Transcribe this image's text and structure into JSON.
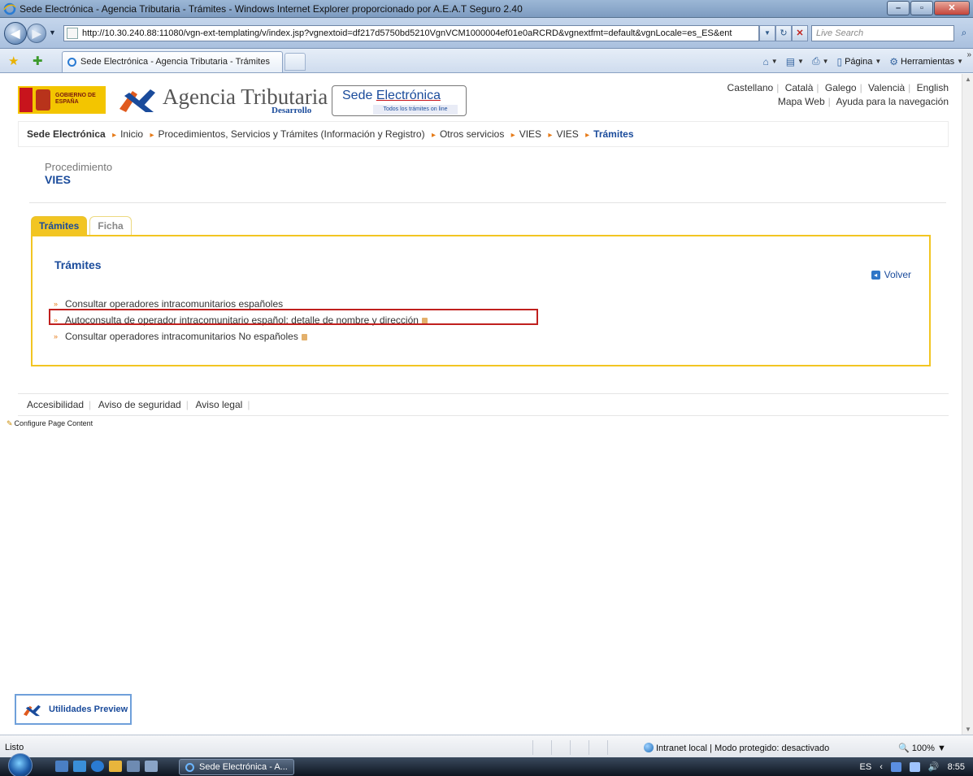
{
  "window": {
    "title": "Sede Electrónica - Agencia Tributaria - Trámites - Windows Internet Explorer proporcionado por A.E.A.T Seguro 2.40",
    "url": "http://10.30.240.88:11080/vgn-ext-templating/v/index.jsp?vgnextoid=df217d5750bd5210VgnVCM1000004ef01e0aRCRD&vgnextfmt=default&vgnLocale=es_ES&ent",
    "search_placeholder": "Live Search",
    "tab_title": "Sede Electrónica - Agencia Tributaria - Trámites",
    "toolbar": {
      "page_label": "Página",
      "tools_label": "Herramientas"
    }
  },
  "header": {
    "gov_logo_text": "GOBIERNO DE ESPAÑA",
    "agency_name": "Agencia Tributaria",
    "agency_sub": "Desarrollo",
    "sede_title_pre": "Sede ",
    "sede_title_u": "Electrónica",
    "sede_tagline": "Todos los trámites on line",
    "languages": [
      "Castellano",
      "Català",
      "Galego",
      "Valencià",
      "English"
    ],
    "links": [
      "Mapa Web",
      "Ayuda para la navegación"
    ]
  },
  "breadcrumb": {
    "root": "Sede Electrónica",
    "items": [
      "Inicio",
      "Procedimientos, Servicios y Trámites (Información y Registro)",
      "Otros servicios",
      "VIES",
      "VIES"
    ],
    "current": "Trámites"
  },
  "procedure": {
    "label": "Procedimiento",
    "name": "VIES"
  },
  "tabs": [
    {
      "label": "Trámites",
      "active": true
    },
    {
      "label": "Ficha",
      "active": false
    }
  ],
  "panel": {
    "title": "Trámites",
    "back_label": "Volver",
    "items": [
      {
        "label": "Consultar operadores intracomunitarios españoles",
        "secure": false
      },
      {
        "label": "Autoconsulta de operador intracomunitario español: detalle de nombre y dirección",
        "secure": true,
        "highlighted": true
      },
      {
        "label": "Consultar operadores intracomunitarios No españoles",
        "secure": true
      }
    ]
  },
  "footer": {
    "links": [
      "Accesibilidad",
      "Aviso de seguridad",
      "Aviso legal"
    ],
    "configure": "Configure Page Content"
  },
  "preview": {
    "label": "Utilidades Preview"
  },
  "statusbar": {
    "status": "Listo",
    "zone": "Intranet local | Modo protegido: desactivado",
    "zoom": "100%"
  },
  "taskbar": {
    "task_label": "Sede Electrónica - A...",
    "lang": "ES",
    "time": "8:55"
  },
  "colors": {
    "brand_blue": "#1a4b9b",
    "tab_yellow": "#f2c522",
    "highlight_red": "#c0201e",
    "bullet_orange": "#e67a17"
  }
}
